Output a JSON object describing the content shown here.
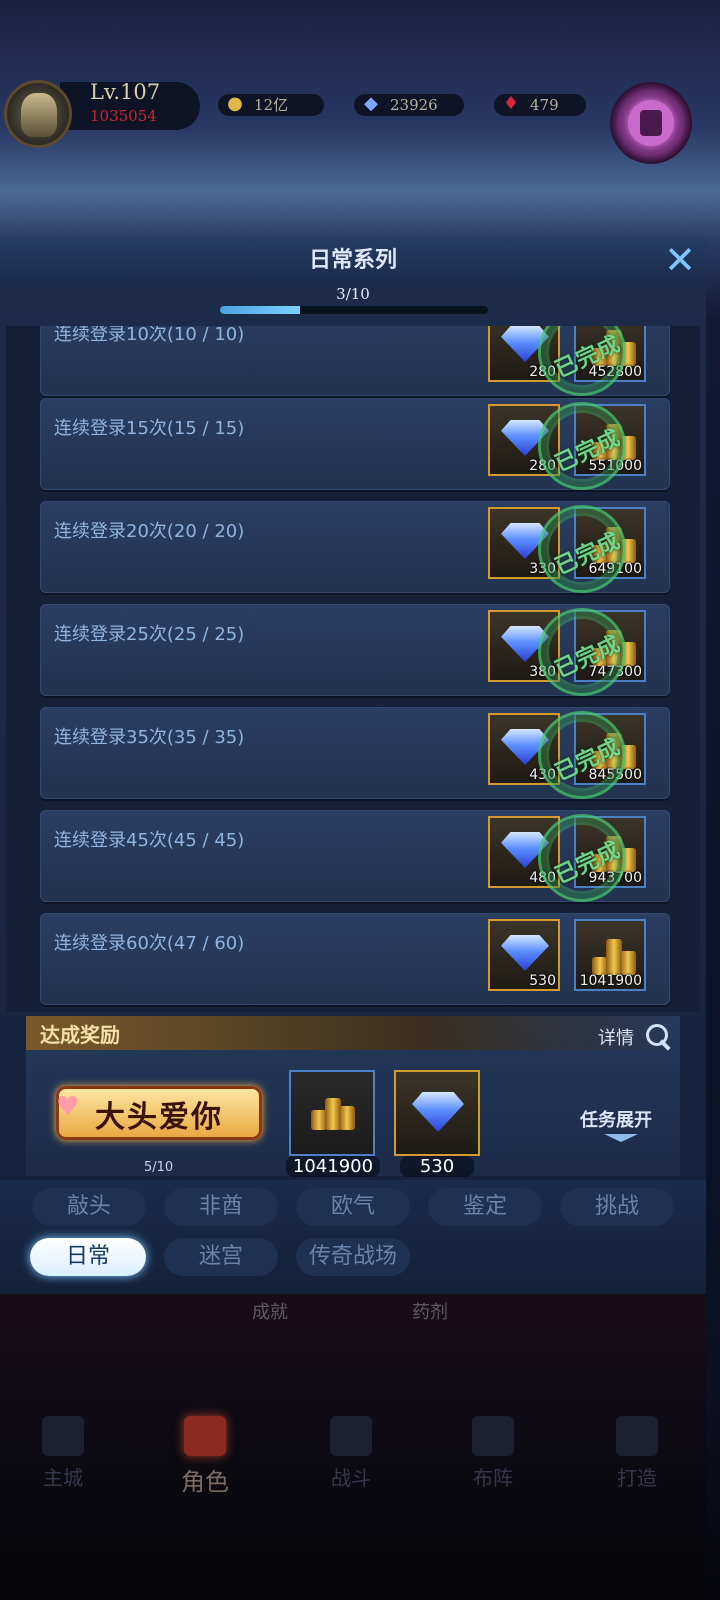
{
  "player": {
    "level": "Lv.107",
    "power": "1035054"
  },
  "resources": [
    {
      "icon": "gold-coin-icon",
      "value": "12亿"
    },
    {
      "icon": "diamond-icon",
      "value": "23926"
    },
    {
      "icon": "ruby-icon",
      "value": "479"
    }
  ],
  "panel": {
    "title": "日常系列",
    "progress_text": "3/10",
    "progress_fraction": 0.3
  },
  "tasks": [
    {
      "label": "连续登录10次(10 / 10)",
      "gem_qty": "280",
      "gold_qty": "452800",
      "stamp": "已完成"
    },
    {
      "label": "连续登录15次(15 / 15)",
      "gem_qty": "280",
      "gold_qty": "551000",
      "stamp": "已完成"
    },
    {
      "label": "连续登录20次(20 / 20)",
      "gem_qty": "330",
      "gold_qty": "649100",
      "stamp": "已完成"
    },
    {
      "label": "连续登录25次(25 / 25)",
      "gem_qty": "380",
      "gold_qty": "747300",
      "stamp": "已完成"
    },
    {
      "label": "连续登录35次(35 / 35)",
      "gem_qty": "430",
      "gold_qty": "845500",
      "stamp": "已完成"
    },
    {
      "label": "连续登录45次(45 / 45)",
      "gem_qty": "480",
      "gold_qty": "943700",
      "stamp": "已完成"
    },
    {
      "label": "连续登录60次(47 / 60)",
      "gem_qty": "530",
      "gold_qty": "1041900",
      "stamp": ""
    }
  ],
  "achievement": {
    "title": "达成奖励",
    "detail": "详情",
    "badge_text": "大头爱你",
    "progress": "5/10",
    "reward_gold": "1041900",
    "reward_gem": "530",
    "expand": "任务展开"
  },
  "tabs": [
    "敲头",
    "非酋",
    "欧气",
    "鉴定",
    "挑战",
    "日常",
    "迷宫",
    "传奇战场"
  ],
  "active_tab": "日常",
  "sub_links": [
    "成就",
    "药剂"
  ],
  "bottom_nav": [
    "主城",
    "角色",
    "战斗",
    "布阵",
    "打造"
  ],
  "active_nav": "角色"
}
